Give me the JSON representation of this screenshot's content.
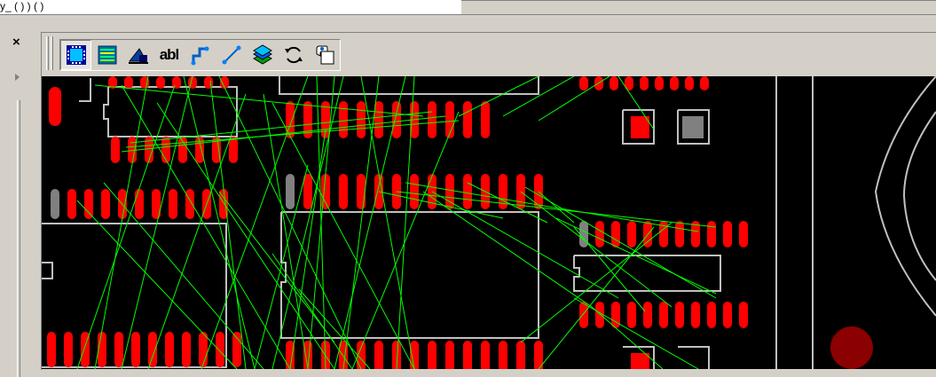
{
  "top_strip": {
    "text": "y_ (   )       )  (   )"
  },
  "dock": {
    "close_glyph": "×",
    "collapse_glyph": "▸"
  },
  "toolbar": {
    "buttons": [
      {
        "name": "component-placement-icon",
        "label": ""
      },
      {
        "name": "layers-icon",
        "label": ""
      },
      {
        "name": "drafting-shape-icon",
        "label": ""
      },
      {
        "name": "text-tool-icon",
        "label": "abl"
      },
      {
        "name": "route-trace-icon",
        "label": ""
      },
      {
        "name": "connection-line-icon",
        "label": ""
      },
      {
        "name": "layer-stack-icon",
        "label": ""
      },
      {
        "name": "refresh-icon",
        "label": ""
      },
      {
        "name": "properties-hand-icon",
        "label": ""
      }
    ]
  },
  "colors": {
    "pad": "#ff0000",
    "pad_gray": "#808080",
    "outline": "#c0c0c0",
    "ratsnest": "#00ff00",
    "background": "#000000",
    "via": "#8b0000"
  }
}
